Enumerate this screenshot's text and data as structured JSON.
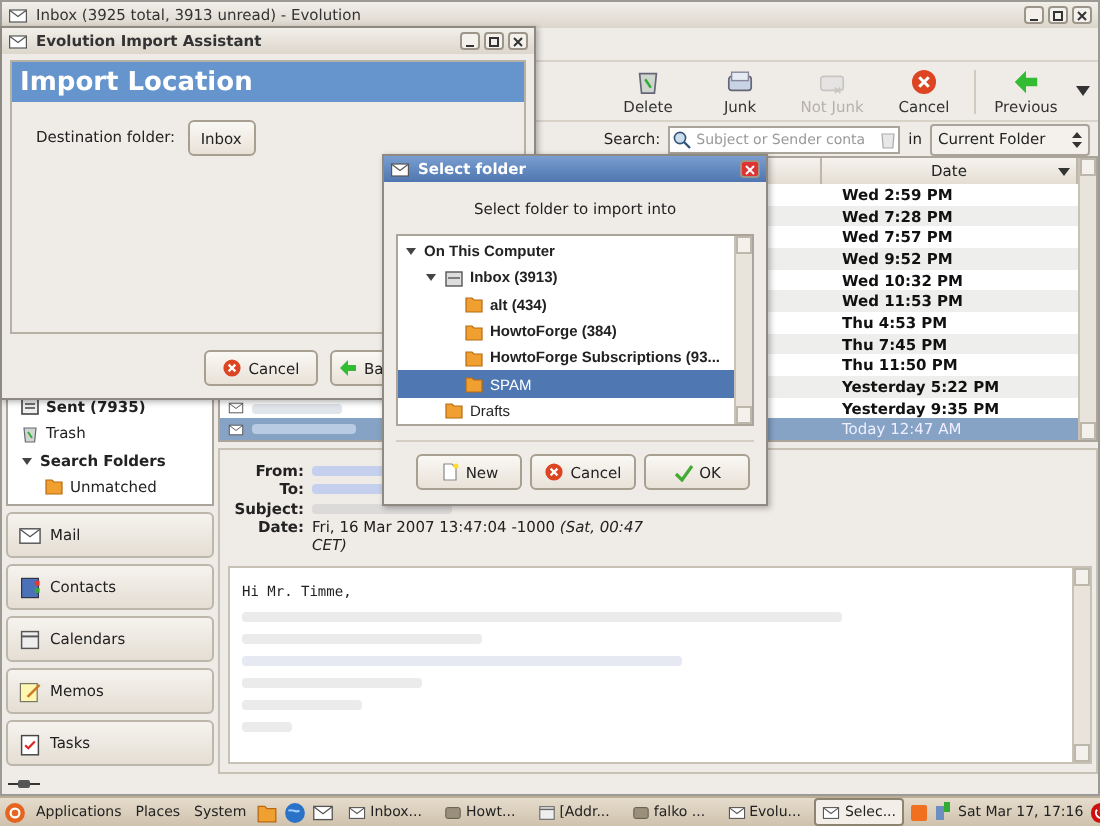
{
  "main_window": {
    "title": "Inbox (3925 total, 3913 unread) - Evolution"
  },
  "toolbar": [
    {
      "label": "Delete",
      "disabled": false
    },
    {
      "label": "Junk",
      "disabled": false
    },
    {
      "label": "Not Junk",
      "disabled": true
    },
    {
      "label": "Cancel",
      "disabled": false
    },
    {
      "label": "Previous",
      "disabled": false
    }
  ],
  "search": {
    "label": "Search:",
    "placeholder": "Subject or Sender conta",
    "scope_label": "in",
    "scope": "Current Folder"
  },
  "folders": [
    {
      "name": "Sent (7935)",
      "kind": "sent",
      "unread": true
    },
    {
      "name": "Trash",
      "kind": "trash",
      "unread": false
    },
    {
      "name": "Search Folders",
      "kind": "group",
      "unread": true,
      "expanded": true,
      "children": [
        {
          "name": "Unmatched",
          "kind": "folder",
          "unread": false
        }
      ]
    }
  ],
  "switcher": [
    {
      "label": "Mail"
    },
    {
      "label": "Contacts"
    },
    {
      "label": "Calendars"
    },
    {
      "label": "Memos"
    },
    {
      "label": "Tasks"
    }
  ],
  "messages": {
    "columns": [
      "Date"
    ],
    "rows": [
      {
        "date": "Wed 2:59 PM",
        "unread": true,
        "selected": false
      },
      {
        "date": "Wed 7:28 PM",
        "unread": true,
        "selected": false
      },
      {
        "date": "Wed 7:57 PM",
        "unread": true,
        "selected": false
      },
      {
        "date": "Wed 9:52 PM",
        "unread": true,
        "selected": false
      },
      {
        "date": "Wed 10:32 PM",
        "unread": true,
        "selected": false
      },
      {
        "date": "Wed 11:53 PM",
        "unread": true,
        "selected": false
      },
      {
        "date": "Thu 4:53 PM",
        "unread": true,
        "selected": false
      },
      {
        "date": "Thu 7:45 PM",
        "unread": true,
        "selected": false
      },
      {
        "date": "Thu 11:50 PM",
        "unread": true,
        "selected": false
      },
      {
        "date": "Yesterday 5:22 PM",
        "unread": true,
        "selected": false
      },
      {
        "date": "Yesterday 9:35 PM",
        "unread": true,
        "selected": false
      },
      {
        "date": "Today 12:47 AM",
        "unread": false,
        "selected": true
      }
    ]
  },
  "preview": {
    "headers": [
      {
        "label": "From:",
        "kind": "link"
      },
      {
        "label": "To:",
        "kind": "link"
      },
      {
        "label": "Subject:",
        "kind": "text"
      },
      {
        "label": "Date:",
        "kind": "date",
        "value": "Fri, 16 Mar 2007 13:47:04 -1000 *(Sat, 00:47 CET)*"
      }
    ],
    "greeting": "Hi Mr. Timme,"
  },
  "import_assistant": {
    "title": "Evolution Import Assistant",
    "heading": "Import Location",
    "field_label": "Destination folder:",
    "folder_button": "Inbox",
    "buttons": [
      {
        "label": "Cancel"
      },
      {
        "label": "Ba"
      }
    ]
  },
  "select_folder": {
    "title": "Select folder",
    "prompt": "Select folder to import into",
    "tree": [
      {
        "name": "On This Computer",
        "unread": true,
        "selected": false,
        "expanded": true,
        "children": [
          {
            "name": "Inbox (3913)",
            "kind": "inbox",
            "unread": true,
            "selected": false,
            "expanded": true,
            "children": [
              {
                "name": "alt (434)",
                "kind": "folder",
                "unread": true,
                "selected": false
              },
              {
                "name": "HowtoForge (384)",
                "kind": "folder",
                "unread": true,
                "selected": false
              },
              {
                "name": "HowtoForge Subscriptions (93...",
                "kind": "folder",
                "unread": true,
                "selected": false
              },
              {
                "name": "SPAM",
                "kind": "folder",
                "unread": false,
                "selected": true
              }
            ]
          },
          {
            "name": "Drafts",
            "kind": "folder",
            "unread": false,
            "selected": false
          }
        ]
      }
    ],
    "buttons": [
      {
        "label": "New"
      },
      {
        "label": "Cancel"
      },
      {
        "label": "OK"
      }
    ]
  },
  "taskbar": {
    "menus": [
      "Applications",
      "Places",
      "System"
    ],
    "tasks": [
      {
        "label": "Inbox...",
        "selected": false
      },
      {
        "label": "Howt...",
        "selected": false
      },
      {
        "label": "[Addr...",
        "selected": false
      },
      {
        "label": "falko ...",
        "selected": false
      },
      {
        "label": "Evolu...",
        "selected": false
      },
      {
        "label": "Selec...",
        "selected": true
      }
    ],
    "clock": "Sat Mar 17, 17:16"
  }
}
